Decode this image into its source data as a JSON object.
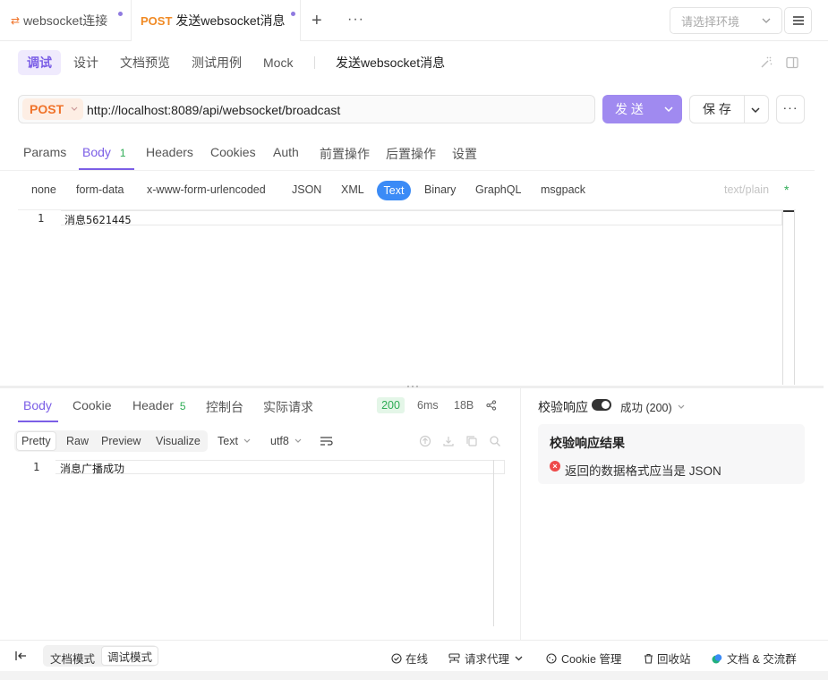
{
  "tabs": [
    {
      "label": "websocket连接"
    },
    {
      "method": "POST",
      "label": "发送websocket消息"
    }
  ],
  "env_select": {
    "placeholder": "请选择环境"
  },
  "mode_tabs": [
    "调试",
    "设计",
    "文档预览",
    "测试用例",
    "Mock"
  ],
  "endpoint_name": "发送websocket消息",
  "request": {
    "method": "POST",
    "url": "http://localhost:8089/api/websocket/broadcast",
    "send_label": "发 送",
    "save_label": "保 存"
  },
  "request_tabs": [
    {
      "label": "Params"
    },
    {
      "label": "Body",
      "badge": "1"
    },
    {
      "label": "Headers"
    },
    {
      "label": "Cookies"
    },
    {
      "label": "Auth"
    },
    {
      "label": "前置操作"
    },
    {
      "label": "后置操作"
    },
    {
      "label": "设置"
    }
  ],
  "body_types": [
    "none",
    "form-data",
    "x-www-form-urlencoded",
    "JSON",
    "XML",
    "Text",
    "Binary",
    "GraphQL",
    "msgpack"
  ],
  "content_type_hint": "text/plain",
  "request_body": {
    "line_no": "1",
    "content": "消息5621445"
  },
  "response": {
    "tabs": [
      {
        "label": "Body"
      },
      {
        "label": "Cookie"
      },
      {
        "label": "Header",
        "badge": "5"
      },
      {
        "label": "控制台"
      },
      {
        "label": "实际请求"
      }
    ],
    "status": "200",
    "time": "6ms",
    "size": "18B",
    "views": [
      "Pretty",
      "Raw",
      "Preview",
      "Visualize"
    ],
    "format": "Text",
    "encoding": "utf8",
    "line_no": "1",
    "content": "消息广播成功"
  },
  "validation": {
    "label": "校验响应",
    "result_select": "成功 (200)",
    "title": "校验响应结果",
    "error": "返回的数据格式应当是 JSON"
  },
  "footer": {
    "doc_mode": "文档模式",
    "debug_mode": "调试模式",
    "online": "在线",
    "proxy": "请求代理",
    "cookie_mgr": "Cookie 管理",
    "recycle": "回收站",
    "community": "文档 & 交流群"
  },
  "colors": {
    "accent": "#7b5ee6",
    "post": "#f0732a",
    "send": "#a08af0",
    "status_ok": "#2eac55",
    "error": "#ee4a4a"
  }
}
